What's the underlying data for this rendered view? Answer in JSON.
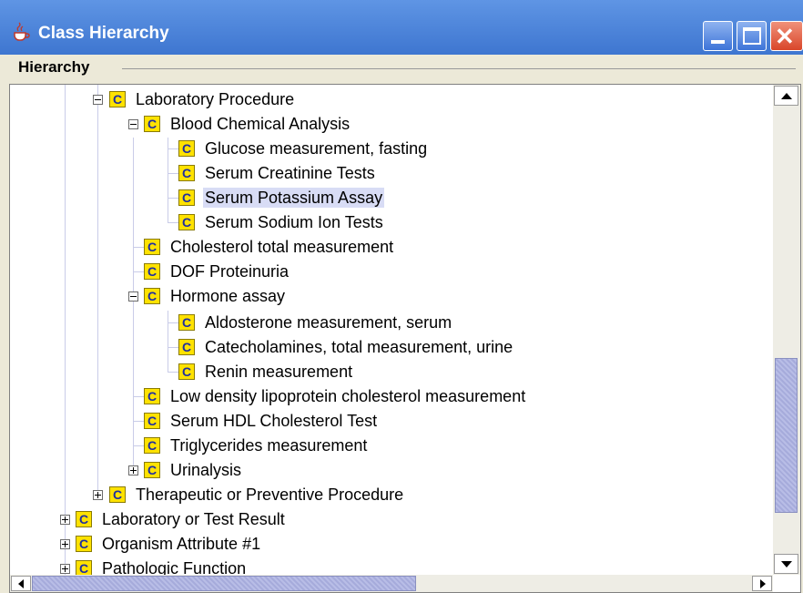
{
  "window": {
    "title": "Class Hierarchy",
    "app_icon": "java-cup-icon",
    "controls": [
      "minimize-icon",
      "maximize-icon",
      "close-icon"
    ]
  },
  "panel": {
    "label": "Hierarchy"
  },
  "tree": {
    "class_icon_letter": "C",
    "selected_color": "#d8dcf5",
    "nodes": [
      {
        "label": "Laboratory Procedure",
        "expanded": true
      },
      {
        "label": "Blood Chemical Analysis",
        "expanded": true
      },
      {
        "label": "Glucose measurement, fasting"
      },
      {
        "label": "Serum Creatinine Tests"
      },
      {
        "label": "Serum Potassium Assay",
        "selected": true
      },
      {
        "label": "Serum Sodium Ion Tests"
      },
      {
        "label": "Cholesterol total measurement"
      },
      {
        "label": "DOF Proteinuria"
      },
      {
        "label": "Hormone assay",
        "expanded": true
      },
      {
        "label": "Aldosterone measurement, serum"
      },
      {
        "label": "Catecholamines, total measurement, urine"
      },
      {
        "label": "Renin measurement"
      },
      {
        "label": "Low density lipoprotein cholesterol measurement"
      },
      {
        "label": "Serum HDL Cholesterol Test"
      },
      {
        "label": "Triglycerides measurement"
      },
      {
        "label": "Urinalysis",
        "expanded": false
      },
      {
        "label": "Therapeutic or Preventive Procedure",
        "expanded": false
      },
      {
        "label": "Laboratory or Test Result",
        "expanded": false
      },
      {
        "label": "Organism Attribute #1",
        "expanded": false
      },
      {
        "label": "Pathologic Function",
        "expanded": false
      }
    ]
  }
}
